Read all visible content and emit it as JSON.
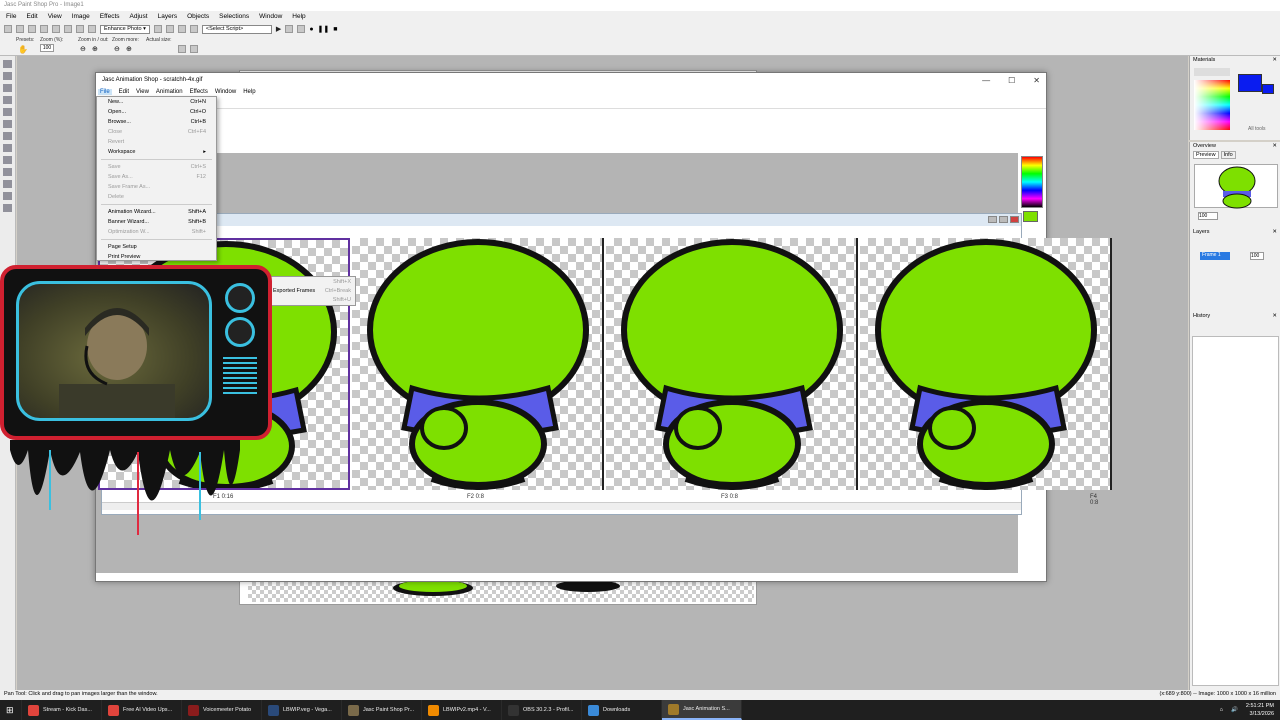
{
  "psp": {
    "title": "Jasc Paint Shop Pro - Image1",
    "menu": [
      "File",
      "Edit",
      "View",
      "Image",
      "Effects",
      "Adjust",
      "Layers",
      "Objects",
      "Selections",
      "Window",
      "Help"
    ],
    "toolbar": {
      "enhance": "Enhance Photo",
      "script_select": "<Select Script>"
    },
    "toolbar2": {
      "presets": "Presets:",
      "zoom_pct": "Zoom (%):",
      "zoom_value": "100",
      "zoom_in_out": "Zoom in / out:",
      "zoom_more": "Zoom more:",
      "actual_size": "Actual size:"
    },
    "palettes": {
      "materials": "Materials",
      "all_tools": "All tools",
      "overview": "Overview",
      "preview_tab": "Preview",
      "info_tab": "Info",
      "overview_zoom": "100",
      "layers": "Layers",
      "layer_name": "Frame 1",
      "layer_opacity": "100",
      "history": "History"
    },
    "status": {
      "left": "Pan Tool: Click and drag to pan images larger than the window.",
      "right": "(x:689 y:800) -- Image: 1000 x 1000 x 16 million"
    }
  },
  "anim": {
    "title": "Jasc Animation Shop - scratchh-4x.gif",
    "menu": [
      "File",
      "Edit",
      "View",
      "Animation",
      "Effects",
      "Window",
      "Help"
    ],
    "frames": [
      {
        "label": "F1 0:16"
      },
      {
        "label": "F2 0:8"
      },
      {
        "label": "F3 0:8"
      },
      {
        "label": "F4 0:8"
      }
    ],
    "colors": {
      "foreground": "#7ee000",
      "body": "#7ee000",
      "shirt": "#5a5ce8"
    }
  },
  "file_menu": [
    {
      "label": "New...",
      "shortcut": "Ctrl+N",
      "disabled": false
    },
    {
      "label": "Open...",
      "shortcut": "Ctrl+O",
      "disabled": false
    },
    {
      "label": "Browse...",
      "shortcut": "Ctrl+B",
      "disabled": false
    },
    {
      "label": "Close",
      "shortcut": "Ctrl+F4",
      "disabled": true
    },
    {
      "label": "Revert",
      "shortcut": "",
      "disabled": true
    },
    {
      "label": "Workspace",
      "shortcut": "▸",
      "disabled": false
    },
    {
      "sep": true
    },
    {
      "label": "Save",
      "shortcut": "Ctrl+S",
      "disabled": true
    },
    {
      "label": "Save As...",
      "shortcut": "F12",
      "disabled": true
    },
    {
      "label": "Save Frame As...",
      "shortcut": "",
      "disabled": true
    },
    {
      "label": "Delete",
      "shortcut": "",
      "disabled": true
    },
    {
      "sep": true
    },
    {
      "label": "Animation Wizard...",
      "shortcut": "Shift+A",
      "disabled": false
    },
    {
      "label": "Banner Wizard...",
      "shortcut": "Shift+B",
      "disabled": false
    },
    {
      "label": "Optimization W...",
      "shortcut": "Shift+",
      "disabled": true
    },
    {
      "sep": true
    },
    {
      "label": "Page Setup",
      "shortcut": "",
      "disabled": false
    },
    {
      "label": "Print Preview",
      "shortcut": "",
      "disabled": false
    }
  ],
  "submenu": [
    {
      "label": "",
      "shortcut": "Shift+X"
    },
    {
      "label": "Exported Frames",
      "shortcut": "Ctrl+Break"
    },
    {
      "label": "",
      "shortcut": "Shift+U"
    }
  ],
  "taskbar": {
    "items": [
      {
        "label": "Stream - Kick Das...",
        "color": "#e0443c"
      },
      {
        "label": "Free AI Video Ups...",
        "color": "#e0443c"
      },
      {
        "label": "Voicemeeter Potato",
        "color": "#8a1c1c"
      },
      {
        "label": "LBWIP.veg - Vega...",
        "color": "#2a4a7a"
      },
      {
        "label": "Jasc Paint Shop Pr...",
        "color": "#7a6a4a"
      },
      {
        "label": "LBWIPv2.mp4 - V...",
        "color": "#f08a00"
      },
      {
        "label": "OBS 30.2.3 - Profil...",
        "color": "#333"
      },
      {
        "label": "Downloads",
        "color": "#3a8ad8"
      },
      {
        "label": "Jasc Animation S...",
        "color": "#a07a2a"
      }
    ],
    "time": "2:51:21 PM",
    "date": "3/13/2026"
  }
}
